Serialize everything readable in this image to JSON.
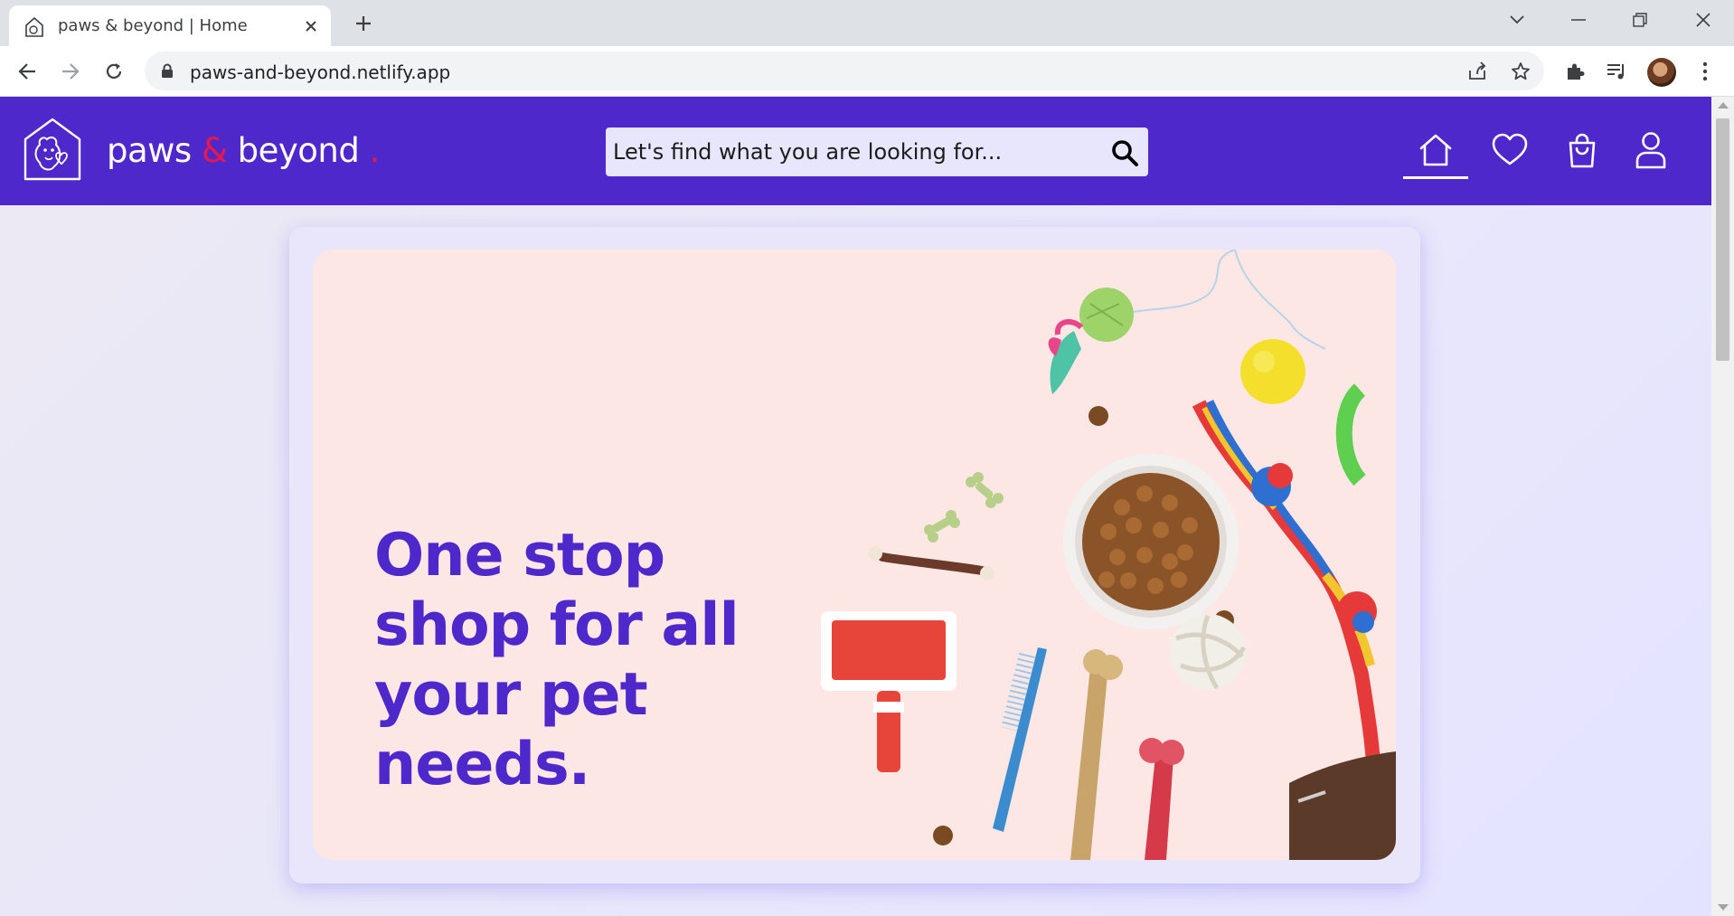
{
  "browser": {
    "tab_title": "paws & beyond | Home",
    "url": "paws-and-beyond.netlify.app"
  },
  "site": {
    "brand_part1": "paws",
    "brand_amp": "&",
    "brand_part2": "beyond",
    "brand_dot": ".",
    "search_placeholder": "Let's find what you are looking for...",
    "nav": [
      "home-icon",
      "wishlist-heart-icon",
      "shopping-bag-icon",
      "user-account-icon"
    ],
    "active_nav": "home",
    "colors": {
      "header": "#4f28cc",
      "accent": "#e8194a",
      "hero_bg": "#fde7e4",
      "hero_text": "#4f28cc"
    }
  },
  "hero": {
    "title": "One stop shop for all your pet needs."
  }
}
